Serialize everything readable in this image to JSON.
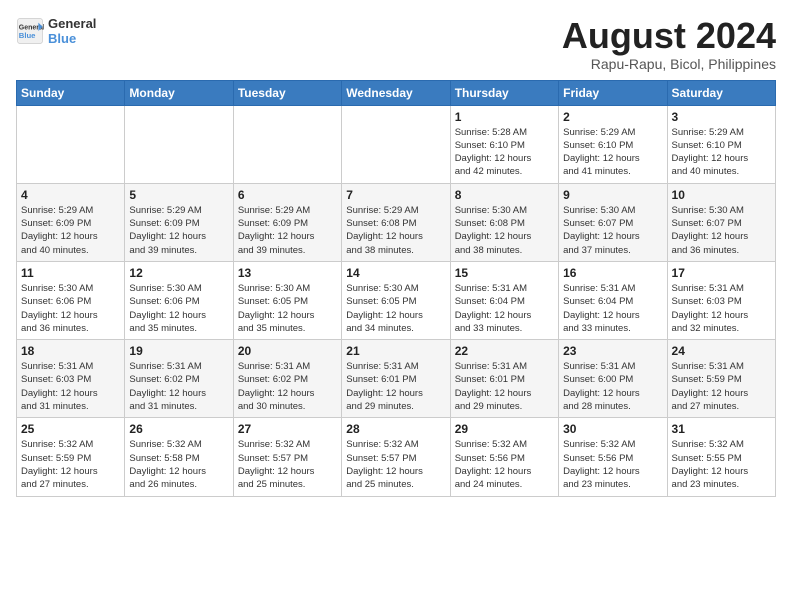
{
  "header": {
    "logo_line1": "General",
    "logo_line2": "Blue",
    "title": "August 2024",
    "subtitle": "Rapu-Rapu, Bicol, Philippines"
  },
  "weekdays": [
    "Sunday",
    "Monday",
    "Tuesday",
    "Wednesday",
    "Thursday",
    "Friday",
    "Saturday"
  ],
  "weeks": [
    [
      {
        "day": "",
        "info": ""
      },
      {
        "day": "",
        "info": ""
      },
      {
        "day": "",
        "info": ""
      },
      {
        "day": "",
        "info": ""
      },
      {
        "day": "1",
        "info": "Sunrise: 5:28 AM\nSunset: 6:10 PM\nDaylight: 12 hours\nand 42 minutes."
      },
      {
        "day": "2",
        "info": "Sunrise: 5:29 AM\nSunset: 6:10 PM\nDaylight: 12 hours\nand 41 minutes."
      },
      {
        "day": "3",
        "info": "Sunrise: 5:29 AM\nSunset: 6:10 PM\nDaylight: 12 hours\nand 40 minutes."
      }
    ],
    [
      {
        "day": "4",
        "info": "Sunrise: 5:29 AM\nSunset: 6:09 PM\nDaylight: 12 hours\nand 40 minutes."
      },
      {
        "day": "5",
        "info": "Sunrise: 5:29 AM\nSunset: 6:09 PM\nDaylight: 12 hours\nand 39 minutes."
      },
      {
        "day": "6",
        "info": "Sunrise: 5:29 AM\nSunset: 6:09 PM\nDaylight: 12 hours\nand 39 minutes."
      },
      {
        "day": "7",
        "info": "Sunrise: 5:29 AM\nSunset: 6:08 PM\nDaylight: 12 hours\nand 38 minutes."
      },
      {
        "day": "8",
        "info": "Sunrise: 5:30 AM\nSunset: 6:08 PM\nDaylight: 12 hours\nand 38 minutes."
      },
      {
        "day": "9",
        "info": "Sunrise: 5:30 AM\nSunset: 6:07 PM\nDaylight: 12 hours\nand 37 minutes."
      },
      {
        "day": "10",
        "info": "Sunrise: 5:30 AM\nSunset: 6:07 PM\nDaylight: 12 hours\nand 36 minutes."
      }
    ],
    [
      {
        "day": "11",
        "info": "Sunrise: 5:30 AM\nSunset: 6:06 PM\nDaylight: 12 hours\nand 36 minutes."
      },
      {
        "day": "12",
        "info": "Sunrise: 5:30 AM\nSunset: 6:06 PM\nDaylight: 12 hours\nand 35 minutes."
      },
      {
        "day": "13",
        "info": "Sunrise: 5:30 AM\nSunset: 6:05 PM\nDaylight: 12 hours\nand 35 minutes."
      },
      {
        "day": "14",
        "info": "Sunrise: 5:30 AM\nSunset: 6:05 PM\nDaylight: 12 hours\nand 34 minutes."
      },
      {
        "day": "15",
        "info": "Sunrise: 5:31 AM\nSunset: 6:04 PM\nDaylight: 12 hours\nand 33 minutes."
      },
      {
        "day": "16",
        "info": "Sunrise: 5:31 AM\nSunset: 6:04 PM\nDaylight: 12 hours\nand 33 minutes."
      },
      {
        "day": "17",
        "info": "Sunrise: 5:31 AM\nSunset: 6:03 PM\nDaylight: 12 hours\nand 32 minutes."
      }
    ],
    [
      {
        "day": "18",
        "info": "Sunrise: 5:31 AM\nSunset: 6:03 PM\nDaylight: 12 hours\nand 31 minutes."
      },
      {
        "day": "19",
        "info": "Sunrise: 5:31 AM\nSunset: 6:02 PM\nDaylight: 12 hours\nand 31 minutes."
      },
      {
        "day": "20",
        "info": "Sunrise: 5:31 AM\nSunset: 6:02 PM\nDaylight: 12 hours\nand 30 minutes."
      },
      {
        "day": "21",
        "info": "Sunrise: 5:31 AM\nSunset: 6:01 PM\nDaylight: 12 hours\nand 29 minutes."
      },
      {
        "day": "22",
        "info": "Sunrise: 5:31 AM\nSunset: 6:01 PM\nDaylight: 12 hours\nand 29 minutes."
      },
      {
        "day": "23",
        "info": "Sunrise: 5:31 AM\nSunset: 6:00 PM\nDaylight: 12 hours\nand 28 minutes."
      },
      {
        "day": "24",
        "info": "Sunrise: 5:31 AM\nSunset: 5:59 PM\nDaylight: 12 hours\nand 27 minutes."
      }
    ],
    [
      {
        "day": "25",
        "info": "Sunrise: 5:32 AM\nSunset: 5:59 PM\nDaylight: 12 hours\nand 27 minutes."
      },
      {
        "day": "26",
        "info": "Sunrise: 5:32 AM\nSunset: 5:58 PM\nDaylight: 12 hours\nand 26 minutes."
      },
      {
        "day": "27",
        "info": "Sunrise: 5:32 AM\nSunset: 5:57 PM\nDaylight: 12 hours\nand 25 minutes."
      },
      {
        "day": "28",
        "info": "Sunrise: 5:32 AM\nSunset: 5:57 PM\nDaylight: 12 hours\nand 25 minutes."
      },
      {
        "day": "29",
        "info": "Sunrise: 5:32 AM\nSunset: 5:56 PM\nDaylight: 12 hours\nand 24 minutes."
      },
      {
        "day": "30",
        "info": "Sunrise: 5:32 AM\nSunset: 5:56 PM\nDaylight: 12 hours\nand 23 minutes."
      },
      {
        "day": "31",
        "info": "Sunrise: 5:32 AM\nSunset: 5:55 PM\nDaylight: 12 hours\nand 23 minutes."
      }
    ]
  ]
}
